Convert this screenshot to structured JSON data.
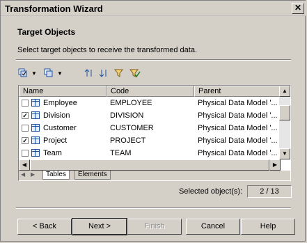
{
  "window": {
    "title": "Transformation Wizard"
  },
  "header": {
    "title": "Target Objects",
    "description": "Select target objects to receive the transformed data."
  },
  "toolbar": {
    "icons": [
      "select-all-icon",
      "deselect-icon",
      "move-up-icon",
      "move-down-icon",
      "filter-icon",
      "check-filter-icon"
    ]
  },
  "grid": {
    "columns": [
      "Name",
      "Code",
      "Parent"
    ],
    "rows": [
      {
        "checked": false,
        "name": "Employee",
        "code": "EMPLOYEE",
        "parent": "Physical Data Model '..."
      },
      {
        "checked": true,
        "name": "Division",
        "code": "DIVISION",
        "parent": "Physical Data Model '..."
      },
      {
        "checked": false,
        "name": "Customer",
        "code": "CUSTOMER",
        "parent": "Physical Data Model '..."
      },
      {
        "checked": true,
        "name": "Project",
        "code": "PROJECT",
        "parent": "Physical Data Model '..."
      },
      {
        "checked": false,
        "name": "Team",
        "code": "TEAM",
        "parent": "Physical Data Model '..."
      }
    ],
    "tabs": [
      "Tables",
      "Elements"
    ]
  },
  "status": {
    "label": "Selected object(s):",
    "value": "2 / 13"
  },
  "buttons": {
    "back": "< Back",
    "next": "Next >",
    "finish": "Finish",
    "cancel": "Cancel",
    "help": "Help"
  }
}
